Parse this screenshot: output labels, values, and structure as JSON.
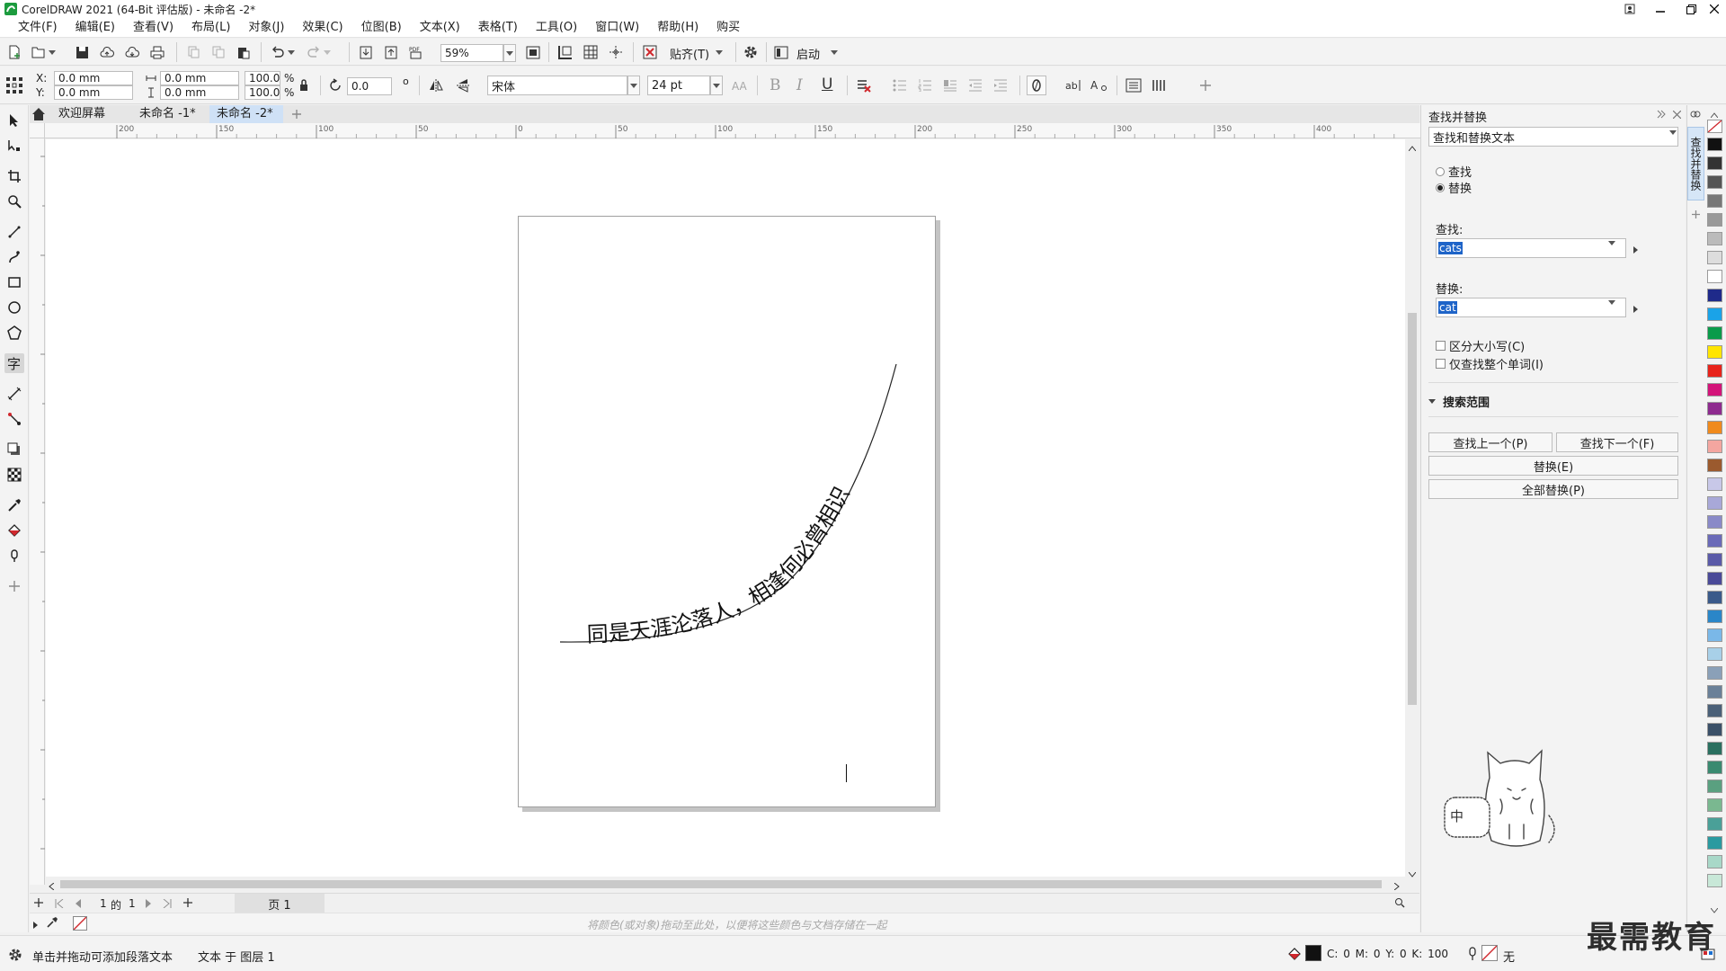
{
  "titlebar": {
    "title": "CorelDRAW 2021 (64-Bit 评估版) - 未命名 -2*"
  },
  "menubar": [
    {
      "label": "文件(F)"
    },
    {
      "label": "编辑(E)"
    },
    {
      "label": "查看(V)"
    },
    {
      "label": "布局(L)"
    },
    {
      "label": "对象(J)"
    },
    {
      "label": "效果(C)"
    },
    {
      "label": "位图(B)"
    },
    {
      "label": "文本(X)"
    },
    {
      "label": "表格(T)"
    },
    {
      "label": "工具(O)"
    },
    {
      "label": "窗口(W)"
    },
    {
      "label": "帮助(H)"
    },
    {
      "label": "购买"
    }
  ],
  "standard_toolbar": {
    "zoom": "59%",
    "snap_label": "贴齐(T)",
    "launch_label": "启动"
  },
  "property_bar": {
    "x_label": "X:",
    "x_value": "0.0 mm",
    "y_label": "Y:",
    "y_value": "0.0 mm",
    "w_value": "0.0 mm",
    "h_value": "0.0 mm",
    "scale_w": "100.0",
    "scale_h": "100.0",
    "percent": "%",
    "rotation": "0.0",
    "degree": "o",
    "font_name": "宋体",
    "font_size": "24 pt",
    "bold": "B",
    "italic": "I",
    "underline": "U"
  },
  "doc_tabs": [
    {
      "label": "欢迎屏幕"
    },
    {
      "label": "未命名 -1*"
    },
    {
      "label": "未命名 -2*"
    }
  ],
  "ruler_h_ticks": [
    "200",
    "150",
    "100",
    "50",
    "0",
    "50",
    "100",
    "150",
    "200",
    "250",
    "300",
    "350",
    "400"
  ],
  "canvas": {
    "path_text": "同是天涯沦落人，相逢何必曾相识"
  },
  "page_nav": {
    "current": "1",
    "of": "的",
    "total": "1",
    "page_tab": "页 1"
  },
  "color_bar": {
    "hint": "将颜色(或对象)拖动至此处，以便将这些颜色与文档存储在一起"
  },
  "status_bar": {
    "hint": "单击并拖动可添加段落文本",
    "layer_info": "文本 于 图层 1",
    "cmyk": "C: 0 M: 0 Y: 0 K: 100",
    "outline": "无"
  },
  "docker": {
    "title": "查找并替换",
    "mode_select": "查找和替换文本",
    "radio_find": "查找",
    "radio_replace": "替换",
    "find_label": "查找:",
    "find_value": "cats",
    "replace_label": "替换:",
    "replace_value": "cat",
    "case_label": "区分大小写(C)",
    "whole_word_label": "仅查找整个单词(I)",
    "scope_label": "搜索范围",
    "find_prev": "查找上一个(P)",
    "find_next": "查找下一个(F)",
    "replace_btn": "替换(E)",
    "replace_all_btn": "全部替换(P)",
    "vertical_tab": "查找并替换",
    "cat_sign": "中"
  },
  "palette_colors": [
    "#111111",
    "#333333",
    "#555555",
    "#777777",
    "#999999",
    "#bbbbbb",
    "#dddddd",
    "#ffffff",
    "#1f2a8a",
    "#1aa3e8",
    "#0a9b4a",
    "#ffe500",
    "#e8231b",
    "#d3147a",
    "#8e2b8f",
    "#f08a1c",
    "#f4a6a0",
    "#9b5a2e",
    "#c8c8e8",
    "#a8a8d8",
    "#8a8ac8",
    "#6a6ab8",
    "#5a5aa8",
    "#4a4a98",
    "#3a5a8a",
    "#2a86c8",
    "#7ab8e8",
    "#a8d0e8",
    "#8aa0b8",
    "#6a8098",
    "#4a6078",
    "#3a5068",
    "#2a7060",
    "#3a8a70",
    "#5aa080",
    "#7ab890",
    "#4aa098",
    "#2a9aa0",
    "#a8d8c8",
    "#c8e8d8"
  ],
  "watermark": "最需教育"
}
